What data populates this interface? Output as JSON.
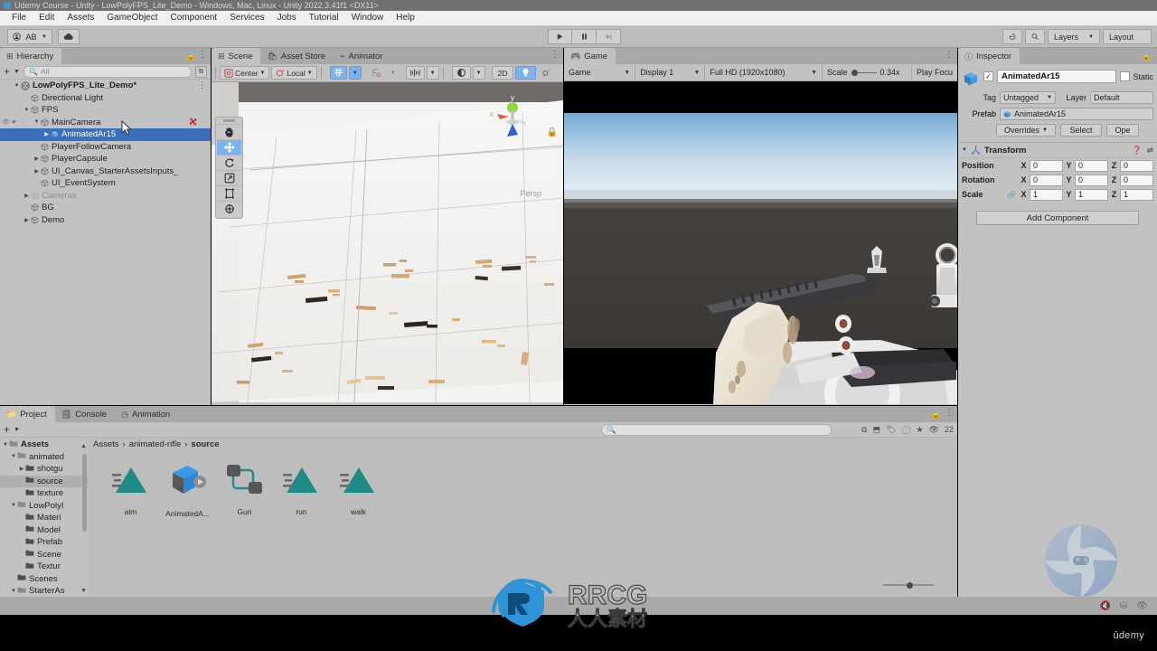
{
  "window": {
    "title": "Udemy Course - Unity - LowPolyFPS_Lite_Demo - Windows, Mac, Linux - Unity 2022.3.41f1 <DX11>"
  },
  "menubar": {
    "items": [
      "File",
      "Edit",
      "Assets",
      "GameObject",
      "Component",
      "Services",
      "Jobs",
      "Tutorial",
      "Window",
      "Help"
    ]
  },
  "toolbar": {
    "account_label": "AB",
    "cloud_icon": "cloud-icon",
    "play_icon": "play-icon",
    "pause_icon": "pause-icon",
    "step_icon": "step-icon",
    "history_icon": "history-icon",
    "search_icon": "search-icon",
    "layers_label": "Layers",
    "layout_label": "Layout"
  },
  "hierarchy": {
    "tab_label": "Hierarchy",
    "search_placeholder": "All",
    "items": [
      {
        "label": "LowPolyFPS_Lite_Demo*",
        "depth": 0,
        "arrow": "down",
        "bold": true,
        "icon": "scene-icon",
        "selected": false,
        "dim": false,
        "dots": true
      },
      {
        "label": "Directional Light",
        "depth": 1,
        "arrow": "none",
        "bold": false,
        "icon": "gameobject-icon",
        "selected": false,
        "dim": false,
        "dots": false
      },
      {
        "label": "FPS",
        "depth": 1,
        "arrow": "down",
        "bold": false,
        "icon": "gameobject-icon",
        "selected": false,
        "dim": false,
        "dots": false
      },
      {
        "label": "MainCamera",
        "depth": 2,
        "arrow": "down",
        "bold": false,
        "icon": "gameobject-icon",
        "selected": false,
        "dim": false,
        "dots": false,
        "eyes": true,
        "prefab_marker": true
      },
      {
        "label": "AnimatedAr15",
        "depth": 3,
        "arrow": "right",
        "bold": false,
        "icon": "prefab-icon",
        "selected": true,
        "dim": false,
        "dots": false
      },
      {
        "label": "PlayerFollowCamera",
        "depth": 2,
        "arrow": "none",
        "bold": false,
        "icon": "gameobject-icon",
        "selected": false,
        "dim": false,
        "dots": false
      },
      {
        "label": "PlayerCapsule",
        "depth": 2,
        "arrow": "right",
        "bold": false,
        "icon": "gameobject-icon",
        "selected": false,
        "dim": false,
        "dots": false
      },
      {
        "label": "UI_Canvas_StarterAssetsInputs_",
        "depth": 2,
        "arrow": "right",
        "bold": false,
        "icon": "gameobject-icon",
        "selected": false,
        "dim": false,
        "dots": false
      },
      {
        "label": "UI_EventSystem",
        "depth": 2,
        "arrow": "none",
        "bold": false,
        "icon": "gameobject-icon",
        "selected": false,
        "dim": false,
        "dots": false
      },
      {
        "label": "Cameras",
        "depth": 1,
        "arrow": "right",
        "bold": false,
        "icon": "gameobject-icon",
        "selected": false,
        "dim": true,
        "dots": false
      },
      {
        "label": "BG",
        "depth": 1,
        "arrow": "none",
        "bold": false,
        "icon": "gameobject-icon",
        "selected": false,
        "dim": false,
        "dots": false
      },
      {
        "label": "Demo",
        "depth": 1,
        "arrow": "right",
        "bold": false,
        "icon": "gameobject-icon",
        "selected": false,
        "dim": false,
        "dots": false
      }
    ]
  },
  "scene": {
    "tabs": [
      {
        "label": "Scene",
        "icon": "scene-grid-icon",
        "active": true
      },
      {
        "label": "Asset Store",
        "icon": "store-icon",
        "active": false
      },
      {
        "label": "Animator",
        "icon": "animator-icon",
        "active": false
      }
    ],
    "toolbar": {
      "pivot_label": "Center",
      "space_label": "Local",
      "grid_icon": "grid-snap-icon",
      "snap_icon": "snap-increment-icon",
      "layer_icon": "audio-icon",
      "lighting_icon": "lighting-icon",
      "twod_label": "2D",
      "light_icon": "light-bulb-icon",
      "fx_icon": "effects-icon"
    },
    "tools": [
      {
        "name": "hand-tool",
        "glyph": "✋",
        "active": false
      },
      {
        "name": "move-tool",
        "glyph": "move",
        "active": true
      },
      {
        "name": "rotate-tool",
        "glyph": "rotate",
        "active": false
      },
      {
        "name": "scale-tool",
        "glyph": "scale",
        "active": false
      },
      {
        "name": "rect-tool",
        "glyph": "rect",
        "active": false
      },
      {
        "name": "transform-tool",
        "glyph": "transform",
        "active": false
      }
    ],
    "gizmo": {
      "x_label": "x",
      "y_label": "y",
      "persp_label": "Persp"
    }
  },
  "game": {
    "tab_label": "Game",
    "mode_label": "Game",
    "display_label": "Display 1",
    "resolution_label": "Full HD (1920x1080)",
    "scale_label": "Scale",
    "scale_value": "0.34x",
    "play_focus_label": "Play Focu"
  },
  "inspector": {
    "tab_label": "Inspector",
    "object_name": "AnimatedAr15",
    "static_label": "Static",
    "tag_label": "Tag",
    "tag_value": "Untagged",
    "layer_label": "Layer",
    "layer_value": "Default",
    "prefab_label": "Prefab",
    "prefab_value": "AnimatedAr15",
    "overrides_label": "Overrides",
    "select_label": "Select",
    "open_label": "Ope",
    "transform": {
      "title": "Transform",
      "rows": [
        {
          "name": "Position",
          "x": "0",
          "y": "0",
          "z": "0"
        },
        {
          "name": "Rotation",
          "x": "0",
          "y": "0",
          "z": "0"
        },
        {
          "name": "Scale",
          "x": "1",
          "y": "1",
          "z": "1"
        }
      ]
    },
    "add_component_label": "Add Component"
  },
  "project": {
    "tabs": [
      {
        "label": "Project",
        "icon": "folder-icon",
        "active": true
      },
      {
        "label": "Console",
        "icon": "console-icon",
        "active": false
      },
      {
        "label": "Animation",
        "icon": "animation-icon",
        "active": false
      }
    ],
    "search_placeholder": "",
    "filter_count": "22",
    "breadcrumbs": [
      "Assets",
      "animated-rifle",
      "source"
    ],
    "tree": [
      {
        "label": "Assets",
        "depth": 0,
        "arrow": "down",
        "bold": true,
        "open": true,
        "sel": false
      },
      {
        "label": "animated",
        "depth": 1,
        "arrow": "down",
        "bold": false,
        "open": true,
        "sel": false
      },
      {
        "label": "shotgu",
        "depth": 2,
        "arrow": "right",
        "bold": false,
        "open": false,
        "sel": false
      },
      {
        "label": "source",
        "depth": 2,
        "arrow": "none",
        "bold": false,
        "open": false,
        "sel": true
      },
      {
        "label": "texture",
        "depth": 2,
        "arrow": "none",
        "bold": false,
        "open": false,
        "sel": false
      },
      {
        "label": "LowPolyI",
        "depth": 1,
        "arrow": "down",
        "bold": false,
        "open": true,
        "sel": false
      },
      {
        "label": "Materi",
        "depth": 2,
        "arrow": "none",
        "bold": false,
        "open": false,
        "sel": false
      },
      {
        "label": "Model",
        "depth": 2,
        "arrow": "none",
        "bold": false,
        "open": false,
        "sel": false
      },
      {
        "label": "Prefab",
        "depth": 2,
        "arrow": "none",
        "bold": false,
        "open": false,
        "sel": false
      },
      {
        "label": "Scene",
        "depth": 2,
        "arrow": "none",
        "bold": false,
        "open": false,
        "sel": false
      },
      {
        "label": "Textur",
        "depth": 2,
        "arrow": "none",
        "bold": false,
        "open": false,
        "sel": false
      },
      {
        "label": "Scenes",
        "depth": 1,
        "arrow": "none",
        "bold": false,
        "open": false,
        "sel": false
      },
      {
        "label": "StarterAs",
        "depth": 1,
        "arrow": "down",
        "bold": false,
        "open": true,
        "sel": false
      }
    ],
    "assets": [
      {
        "label": "aim",
        "icon": "animation-clip-icon"
      },
      {
        "label": "AnimatedA...",
        "icon": "fbx-model-icon"
      },
      {
        "label": "Gun",
        "icon": "animator-controller-icon"
      },
      {
        "label": "run",
        "icon": "animation-clip-icon"
      },
      {
        "label": "walk",
        "icon": "animation-clip-icon"
      }
    ]
  },
  "watermarks": {
    "rrcg_text": "RRCG",
    "rrcg_sub": "人人素材",
    "udemy_text": "ûdemy"
  }
}
